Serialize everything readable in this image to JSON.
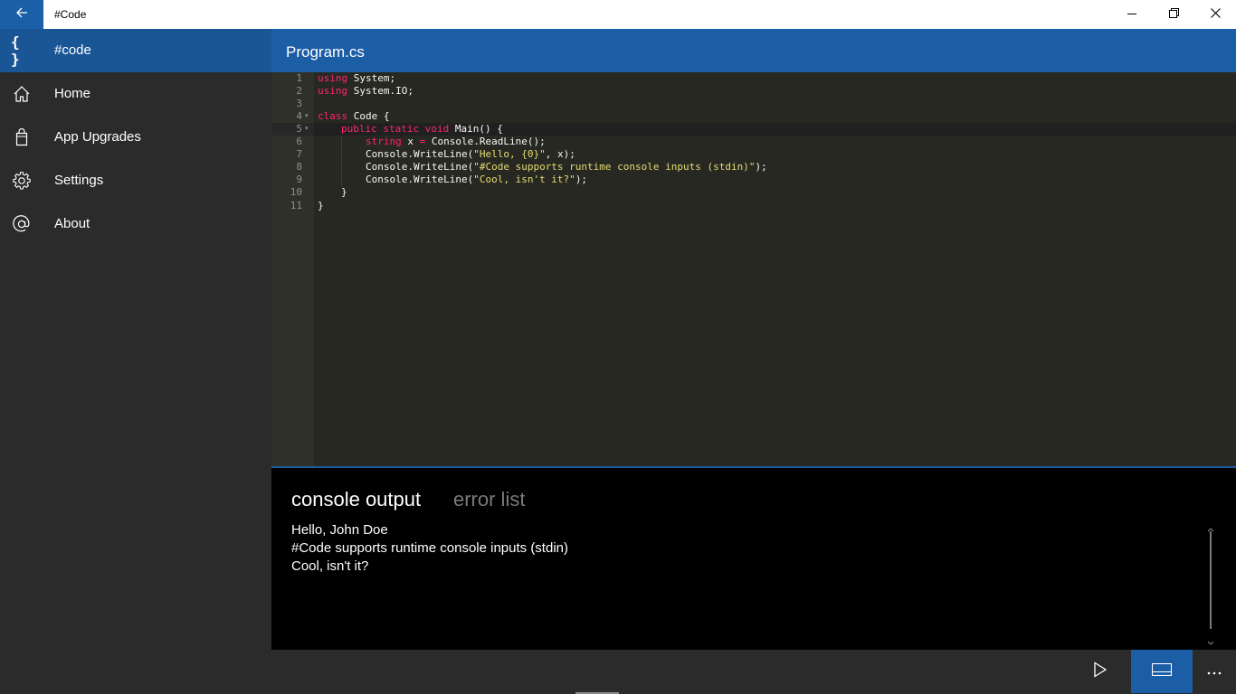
{
  "window": {
    "title": "#Code",
    "back_icon": "arrow-left-icon",
    "controls": [
      "minimize-icon",
      "restore-icon",
      "close-icon"
    ]
  },
  "sidebar": {
    "header": {
      "icon": "{ }",
      "label": "#code"
    },
    "items": [
      {
        "label": "Home",
        "icon": "home-icon"
      },
      {
        "label": "App Upgrades",
        "icon": "shopping-bag-icon"
      },
      {
        "label": "Settings",
        "icon": "gear-icon"
      },
      {
        "label": "About",
        "icon": "at-sign-icon"
      }
    ]
  },
  "editor": {
    "filename": "Program.cs",
    "line_numbers": [
      "1",
      "2",
      "3",
      "4",
      "5",
      "6",
      "7",
      "8",
      "9",
      "10",
      "11"
    ],
    "code": {
      "l1": [
        "using",
        " System;"
      ],
      "l2": [
        "using",
        " System.IO;"
      ],
      "l4": [
        "class",
        " Code {"
      ],
      "l5": [
        "public",
        "static",
        "void",
        " Main() {"
      ],
      "l6": [
        "string",
        " x ",
        "=",
        " Console.ReadLine();"
      ],
      "l7": [
        "Console.WriteLine(",
        "\"Hello, {0}\"",
        ", x);"
      ],
      "l8": [
        "Console.WriteLine(",
        "\"#Code supports runtime console inputs (stdin)\"",
        ");"
      ],
      "l9": [
        "Console.WriteLine(",
        "\"Cool, isn't it?\"",
        ");"
      ],
      "l10": "}",
      "l11": "}"
    },
    "colors": {
      "background": "#272822",
      "keyword": "#f92672",
      "string": "#e6db74",
      "text": "#f8f8f2"
    }
  },
  "output": {
    "tabs": [
      {
        "label": "console output",
        "active": true
      },
      {
        "label": "error list",
        "active": false
      }
    ],
    "lines": [
      "Hello, John Doe",
      "#Code supports runtime console inputs (stdin)",
      "Cool, isn't it?"
    ]
  },
  "command_bar": {
    "buttons": [
      "run-icon",
      "toggle-output-panel-icon",
      "more-icon"
    ]
  },
  "accent_color": "#1b5ea6"
}
